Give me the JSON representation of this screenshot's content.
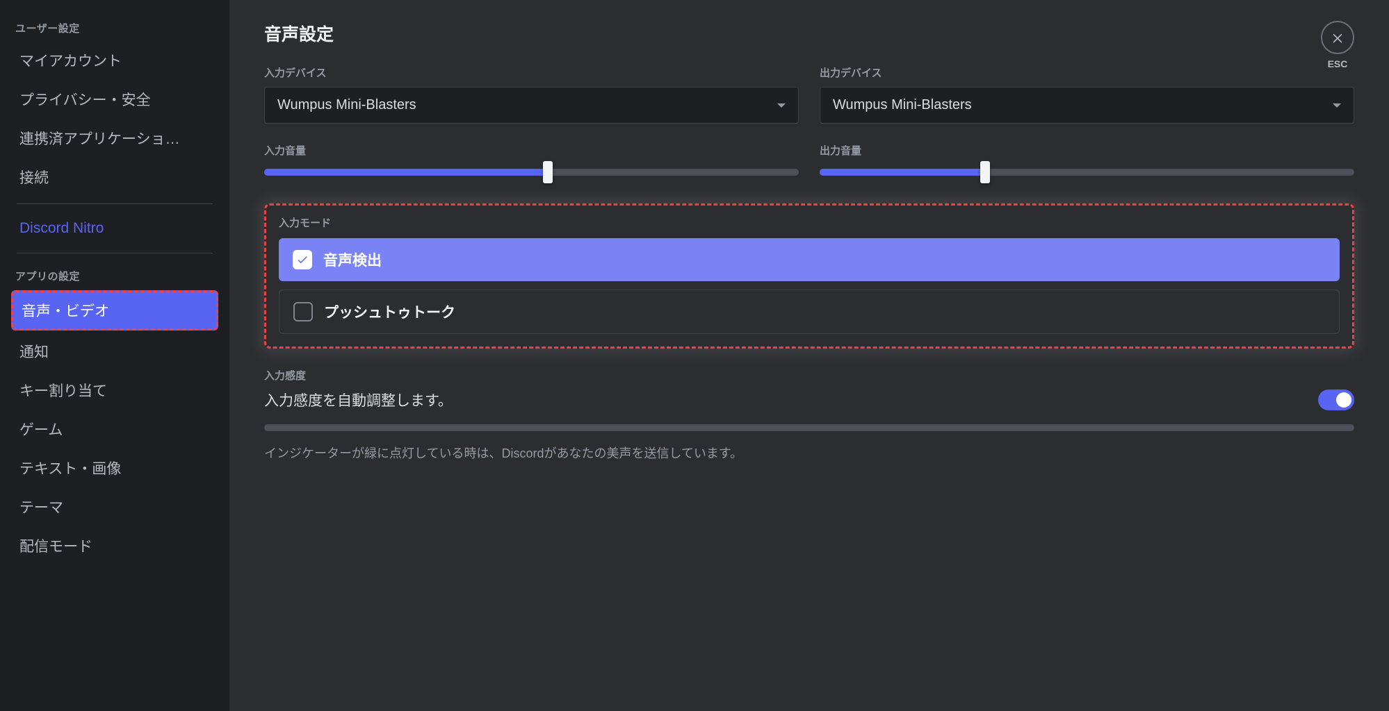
{
  "sidebar": {
    "category_user": "ユーザー設定",
    "items_user": [
      {
        "label": "マイアカウント"
      },
      {
        "label": "プライバシー・安全"
      },
      {
        "label": "連携済アプリケーショ…"
      },
      {
        "label": "接続"
      }
    ],
    "nitro_label": "Discord Nitro",
    "category_app": "アプリの設定",
    "items_app": [
      {
        "label": "音声・ビデオ",
        "active": true
      },
      {
        "label": "通知"
      },
      {
        "label": "キー割り当て"
      },
      {
        "label": "ゲーム"
      },
      {
        "label": "テキスト・画像"
      },
      {
        "label": "テーマ"
      },
      {
        "label": "配信モード"
      }
    ]
  },
  "close": {
    "esc": "ESC"
  },
  "content": {
    "title": "音声設定",
    "input_device_label": "入力デバイス",
    "output_device_label": "出力デバイス",
    "input_device_value": "Wumpus Mini-Blasters",
    "output_device_value": "Wumpus Mini-Blasters",
    "input_volume_label": "入力音量",
    "output_volume_label": "出力音量",
    "input_volume_pct": 53,
    "output_volume_pct": 31,
    "input_mode_label": "入力モード",
    "mode_voice": "音声検出",
    "mode_ptt": "プッシュトゥトーク",
    "sensitivity_label": "入力感度",
    "sensitivity_desc": "入力感度を自動調整します。",
    "indicator_hint": "インジケーターが緑に点灯している時は、Discordがあなたの美声を送信しています。"
  }
}
